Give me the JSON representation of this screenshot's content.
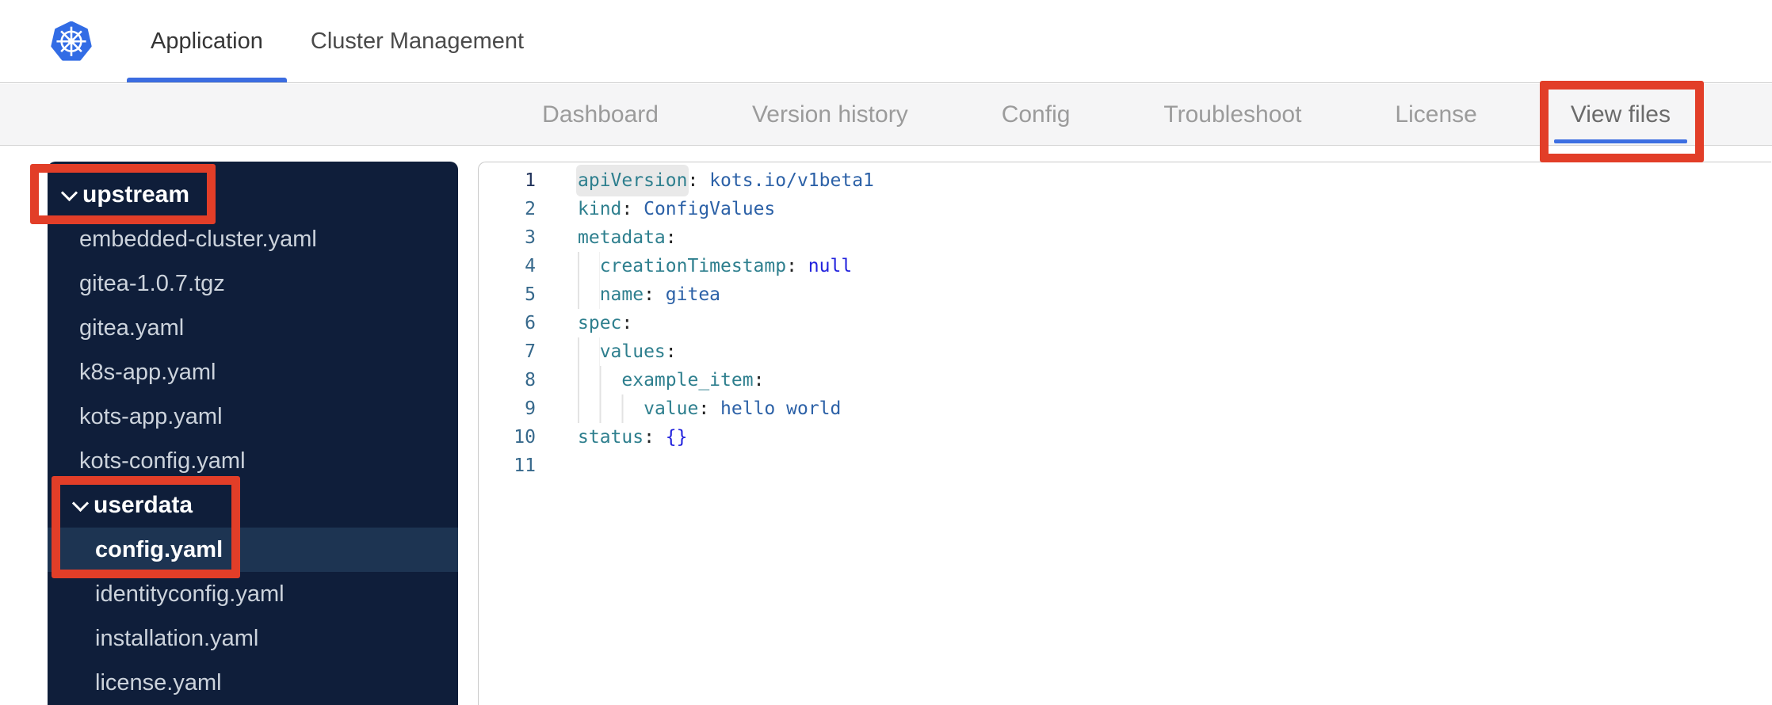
{
  "header": {
    "tabs": [
      {
        "label": "Application",
        "active": true
      },
      {
        "label": "Cluster Management",
        "active": false
      }
    ]
  },
  "nav": {
    "tabs": [
      {
        "label": "Dashboard",
        "active": false
      },
      {
        "label": "Version history",
        "active": false
      },
      {
        "label": "Config",
        "active": false
      },
      {
        "label": "Troubleshoot",
        "active": false
      },
      {
        "label": "License",
        "active": false
      },
      {
        "label": "View files",
        "active": true
      }
    ]
  },
  "sidebar": {
    "items": [
      {
        "label": "upstream",
        "type": "folder",
        "level": 1,
        "expanded": true,
        "selected": false
      },
      {
        "label": "embedded-cluster.yaml",
        "type": "file",
        "level": 1,
        "selected": false
      },
      {
        "label": "gitea-1.0.7.tgz",
        "type": "file",
        "level": 1,
        "selected": false
      },
      {
        "label": "gitea.yaml",
        "type": "file",
        "level": 1,
        "selected": false
      },
      {
        "label": "k8s-app.yaml",
        "type": "file",
        "level": 1,
        "selected": false
      },
      {
        "label": "kots-app.yaml",
        "type": "file",
        "level": 1,
        "selected": false
      },
      {
        "label": "kots-config.yaml",
        "type": "file",
        "level": 1,
        "selected": false
      },
      {
        "label": "userdata",
        "type": "folder",
        "level": 2,
        "expanded": true,
        "selected": false
      },
      {
        "label": "config.yaml",
        "type": "file",
        "level": 2,
        "selected": true
      },
      {
        "label": "identityconfig.yaml",
        "type": "file",
        "level": 2,
        "selected": false
      },
      {
        "label": "installation.yaml",
        "type": "file",
        "level": 2,
        "selected": false
      },
      {
        "label": "license.yaml",
        "type": "file",
        "level": 2,
        "selected": false
      }
    ]
  },
  "editor": {
    "language": "yaml",
    "colon": ": ",
    "lines": [
      {
        "num": "1",
        "indent": 0,
        "key": "apiVersion",
        "value": "kots.io/v1beta1",
        "value_type": "string",
        "word_highlight": true,
        "active_line": true
      },
      {
        "num": "2",
        "indent": 0,
        "key": "kind",
        "value": "ConfigValues",
        "value_type": "string"
      },
      {
        "num": "3",
        "indent": 0,
        "key": "metadata"
      },
      {
        "num": "4",
        "indent": 2,
        "key": "creationTimestamp",
        "value": "null",
        "value_type": "constant"
      },
      {
        "num": "5",
        "indent": 2,
        "key": "name",
        "value": "gitea",
        "value_type": "string"
      },
      {
        "num": "6",
        "indent": 0,
        "key": "spec"
      },
      {
        "num": "7",
        "indent": 2,
        "key": "values"
      },
      {
        "num": "8",
        "indent": 4,
        "key": "example_item"
      },
      {
        "num": "9",
        "indent": 6,
        "key": "value",
        "value": "hello world",
        "value_type": "string"
      },
      {
        "num": "10",
        "indent": 0,
        "key": "status",
        "value": "{}",
        "value_type": "constant"
      },
      {
        "num": "11"
      }
    ]
  },
  "annotations": {
    "color": "#e23e28",
    "boxes": [
      {
        "target": "view-files-tab"
      },
      {
        "target": "upstream-folder"
      },
      {
        "target": "userdata-config-yaml"
      }
    ]
  },
  "colors": {
    "kubernetes_blue": "#326ce5",
    "active_tab_underline": "#3b6ce0",
    "nav_background": "#f5f5f6",
    "sidebar_background": "#0f1e3a",
    "sidebar_selected_row": "#1d3452",
    "code_key": "#2e7f8e",
    "code_string": "#2c61a7",
    "code_constant": "#2222dd",
    "line_number": "#37698c",
    "annotation_red": "#e23e28"
  }
}
